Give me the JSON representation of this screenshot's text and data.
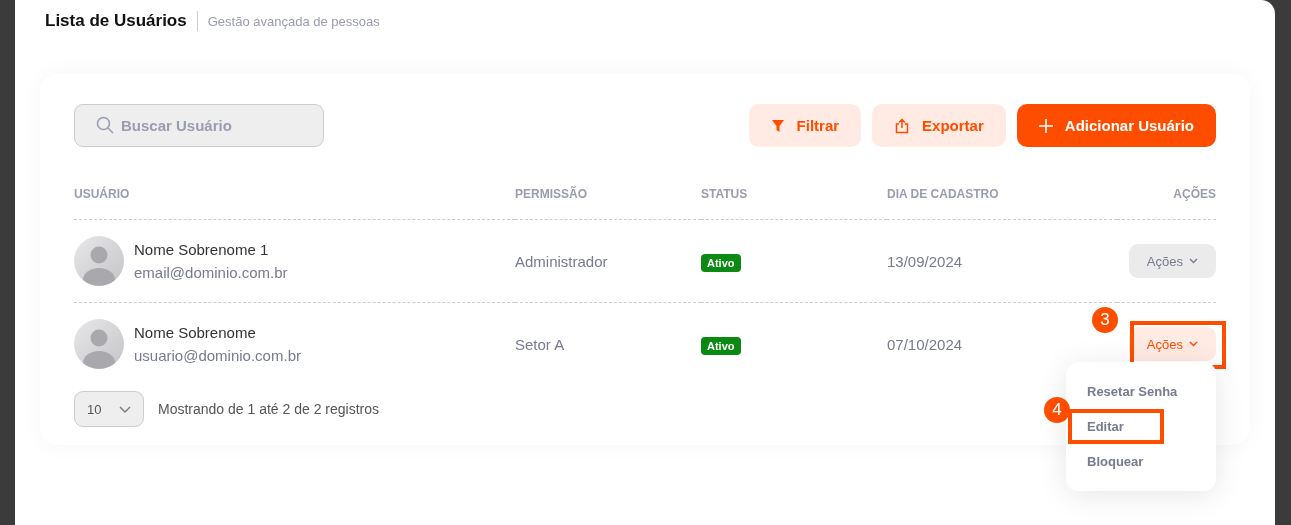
{
  "header": {
    "title": "Lista de Usuários",
    "subtitle": "Gestão avançada de pessoas"
  },
  "search": {
    "placeholder": "Buscar Usuário"
  },
  "buttons": [
    {
      "kind": "filter",
      "label": "Filtrar"
    },
    {
      "kind": "export",
      "label": "Exportar"
    },
    {
      "kind": "add",
      "label": "Adicionar Usuário"
    }
  ],
  "table": {
    "columns": [
      "USUÁRIO",
      "PERMISSÃO",
      "STATUS",
      "DIA DE CADASTRO",
      "AÇÕES"
    ],
    "rows": [
      {
        "name": "Nome Sobrenome 1",
        "email": "email@dominio.com.br",
        "permission": "Administrador",
        "status": "Ativo",
        "date": "13/09/2024",
        "actions": "Ações",
        "open": false
      },
      {
        "name": "Nome Sobrenome",
        "email": "usuario@dominio.com.br",
        "permission": "Setor A",
        "status": "Ativo",
        "date": "07/10/2024",
        "actions": "Ações",
        "open": true,
        "callout": "3"
      }
    ]
  },
  "menu": {
    "items": [
      {
        "label": "Resetar Senha"
      },
      {
        "label": "Editar",
        "callout": "4"
      },
      {
        "label": "Bloquear"
      }
    ]
  },
  "pagination": {
    "page_size": "10",
    "summary": "Mostrando de 1 até 2 de 2 registros"
  }
}
